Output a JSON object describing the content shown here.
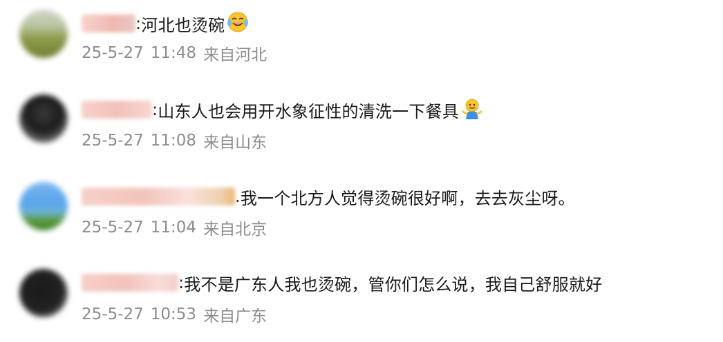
{
  "comments": [
    {
      "separator": ":",
      "text": "河北也烫碗",
      "emoji": "laughing-tears-emoji",
      "date": "25-5-27",
      "time": "11:48",
      "location": "来自河北"
    },
    {
      "separator": ":",
      "text": "山东人也会用开水象征性的清洗一下餐具",
      "emoji": "shrug-emoji",
      "date": "25-5-27",
      "time": "11:08",
      "location": "来自山东"
    },
    {
      "separator": ".",
      "text": "我一个北方人觉得烫碗很好啊，去去灰尘呀。",
      "emoji": "",
      "date": "25-5-27",
      "time": "11:04",
      "location": "来自北京"
    },
    {
      "separator": ":",
      "text": "我不是广东人我也烫碗，管你们怎么说，我自己舒服就好",
      "emoji": "",
      "date": "25-5-27",
      "time": "10:53",
      "location": "来自广东"
    }
  ],
  "colors": {
    "text": "#1a1a1a",
    "meta": "#8c8c8c",
    "name_blur": "#f4c6c0"
  }
}
